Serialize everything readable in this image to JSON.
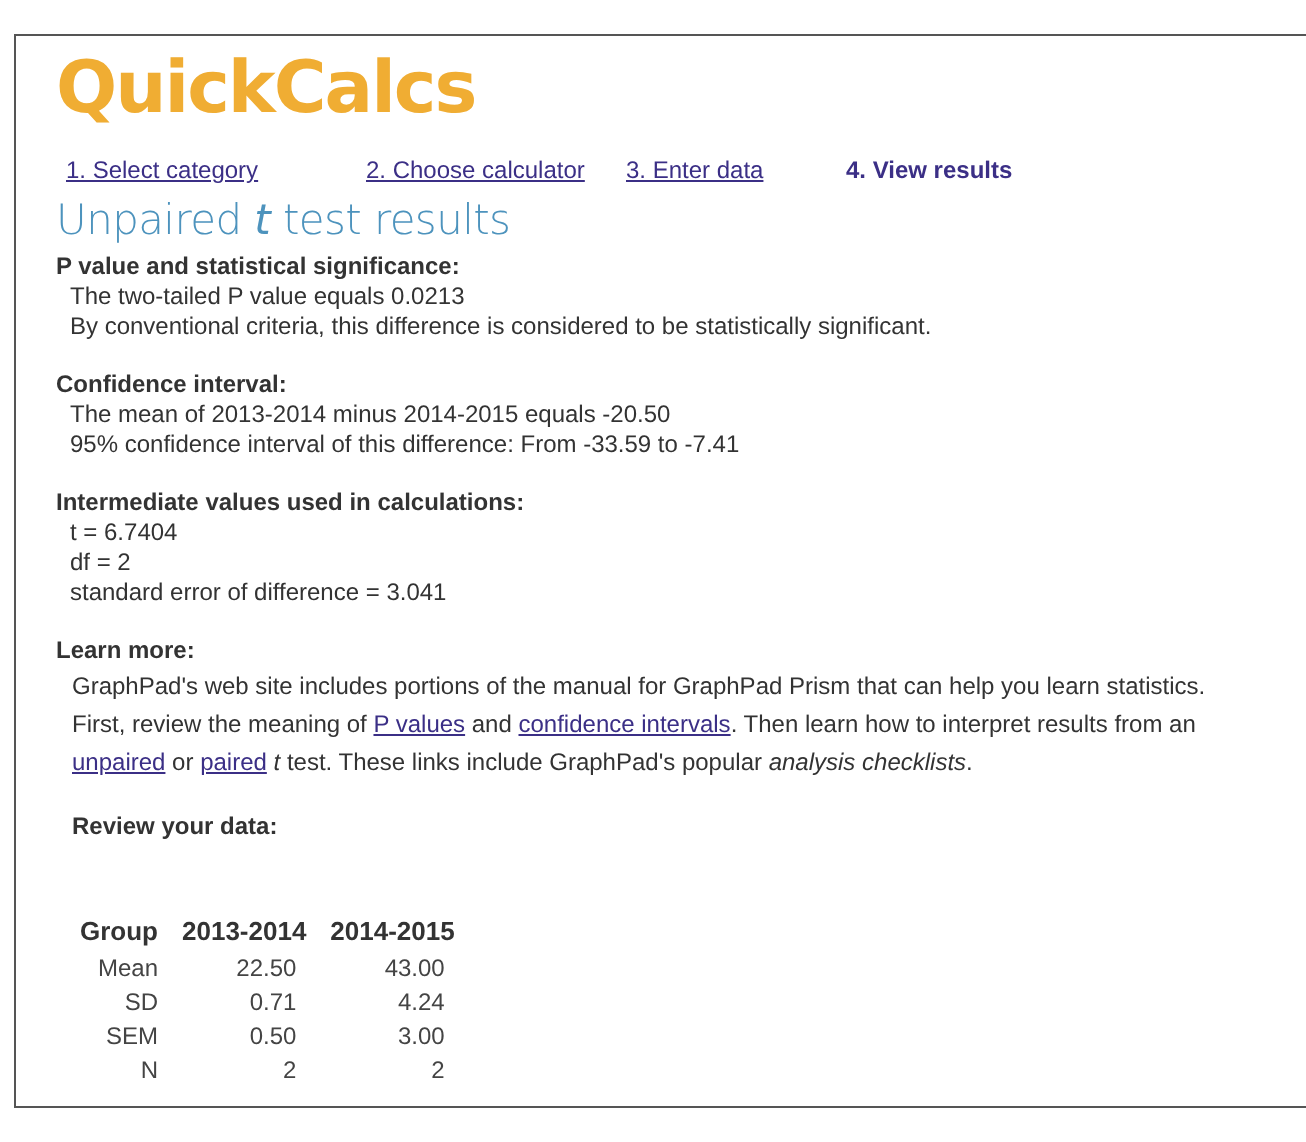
{
  "logo": "QuickCalcs",
  "steps": [
    {
      "label": "1. Select category",
      "selected": false
    },
    {
      "label": "2. Choose calculator",
      "selected": false
    },
    {
      "label": "3. Enter data",
      "selected": false
    },
    {
      "label": "4. View results",
      "selected": true
    }
  ],
  "title": "Unpaired *t* test results",
  "sections": [
    {
      "heading": "P value and statistical significance:",
      "lines": [
        "The two-tailed P value equals 0.0213",
        "By conventional criteria, this difference is considered to be statistically significant."
      ]
    },
    {
      "heading": "Confidence interval:",
      "lines": [
        "The mean of 2013-2014 minus 2014-2015 equals -20.50",
        "95% confidence interval of this difference: From -33.59 to -7.41"
      ]
    },
    {
      "heading": "Intermediate values used in calculations:",
      "lines": [
        "t = 6.7404",
        "df = 2",
        "standard error of difference = 3.041"
      ]
    }
  ],
  "learn_more": {
    "heading": "Learn more:",
    "parts": [
      {
        "kind": "text",
        "text": "GraphPad's web site includes portions of the manual for GraphPad Prism that can help you learn statistics. First, review the meaning of "
      },
      {
        "kind": "link",
        "text": "P values"
      },
      {
        "kind": "text",
        "text": " and "
      },
      {
        "kind": "link",
        "text": "confidence intervals"
      },
      {
        "kind": "text",
        "text": ". Then learn how to interpret results from an "
      },
      {
        "kind": "link",
        "text": "unpaired"
      },
      {
        "kind": "text",
        "text": " or "
      },
      {
        "kind": "link",
        "text": "paired"
      },
      {
        "kind": "text",
        "text": " *t* test. These links include GraphPad's popular *analysis checklists*."
      }
    ]
  },
  "review": {
    "heading": "Review your data:",
    "columns": [
      "Group",
      "2013-2014",
      "2014-2015"
    ],
    "rows": [
      [
        "Mean",
        "22.50",
        "43.00"
      ],
      [
        "SD",
        "0.71",
        "4.24"
      ],
      [
        "SEM",
        "0.50",
        "3.00"
      ],
      [
        "N",
        "2",
        "2"
      ]
    ]
  }
}
